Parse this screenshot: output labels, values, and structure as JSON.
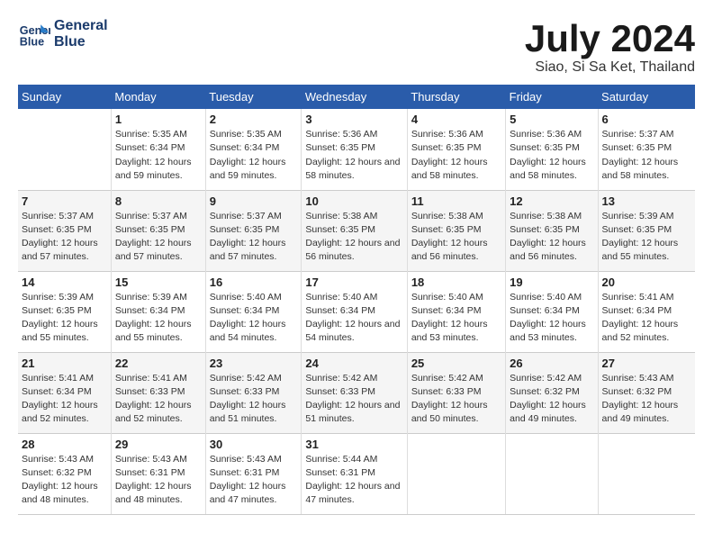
{
  "logo": {
    "line1": "General",
    "line2": "Blue"
  },
  "title": "July 2024",
  "location": "Siao, Si Sa Ket, Thailand",
  "headers": [
    "Sunday",
    "Monday",
    "Tuesday",
    "Wednesday",
    "Thursday",
    "Friday",
    "Saturday"
  ],
  "weeks": [
    [
      {
        "day": "",
        "sunrise": "",
        "sunset": "",
        "daylight": ""
      },
      {
        "day": "1",
        "sunrise": "Sunrise: 5:35 AM",
        "sunset": "Sunset: 6:34 PM",
        "daylight": "Daylight: 12 hours and 59 minutes."
      },
      {
        "day": "2",
        "sunrise": "Sunrise: 5:35 AM",
        "sunset": "Sunset: 6:34 PM",
        "daylight": "Daylight: 12 hours and 59 minutes."
      },
      {
        "day": "3",
        "sunrise": "Sunrise: 5:36 AM",
        "sunset": "Sunset: 6:35 PM",
        "daylight": "Daylight: 12 hours and 58 minutes."
      },
      {
        "day": "4",
        "sunrise": "Sunrise: 5:36 AM",
        "sunset": "Sunset: 6:35 PM",
        "daylight": "Daylight: 12 hours and 58 minutes."
      },
      {
        "day": "5",
        "sunrise": "Sunrise: 5:36 AM",
        "sunset": "Sunset: 6:35 PM",
        "daylight": "Daylight: 12 hours and 58 minutes."
      },
      {
        "day": "6",
        "sunrise": "Sunrise: 5:37 AM",
        "sunset": "Sunset: 6:35 PM",
        "daylight": "Daylight: 12 hours and 58 minutes."
      }
    ],
    [
      {
        "day": "7",
        "sunrise": "Sunrise: 5:37 AM",
        "sunset": "Sunset: 6:35 PM",
        "daylight": "Daylight: 12 hours and 57 minutes."
      },
      {
        "day": "8",
        "sunrise": "Sunrise: 5:37 AM",
        "sunset": "Sunset: 6:35 PM",
        "daylight": "Daylight: 12 hours and 57 minutes."
      },
      {
        "day": "9",
        "sunrise": "Sunrise: 5:37 AM",
        "sunset": "Sunset: 6:35 PM",
        "daylight": "Daylight: 12 hours and 57 minutes."
      },
      {
        "day": "10",
        "sunrise": "Sunrise: 5:38 AM",
        "sunset": "Sunset: 6:35 PM",
        "daylight": "Daylight: 12 hours and 56 minutes."
      },
      {
        "day": "11",
        "sunrise": "Sunrise: 5:38 AM",
        "sunset": "Sunset: 6:35 PM",
        "daylight": "Daylight: 12 hours and 56 minutes."
      },
      {
        "day": "12",
        "sunrise": "Sunrise: 5:38 AM",
        "sunset": "Sunset: 6:35 PM",
        "daylight": "Daylight: 12 hours and 56 minutes."
      },
      {
        "day": "13",
        "sunrise": "Sunrise: 5:39 AM",
        "sunset": "Sunset: 6:35 PM",
        "daylight": "Daylight: 12 hours and 55 minutes."
      }
    ],
    [
      {
        "day": "14",
        "sunrise": "Sunrise: 5:39 AM",
        "sunset": "Sunset: 6:35 PM",
        "daylight": "Daylight: 12 hours and 55 minutes."
      },
      {
        "day": "15",
        "sunrise": "Sunrise: 5:39 AM",
        "sunset": "Sunset: 6:34 PM",
        "daylight": "Daylight: 12 hours and 55 minutes."
      },
      {
        "day": "16",
        "sunrise": "Sunrise: 5:40 AM",
        "sunset": "Sunset: 6:34 PM",
        "daylight": "Daylight: 12 hours and 54 minutes."
      },
      {
        "day": "17",
        "sunrise": "Sunrise: 5:40 AM",
        "sunset": "Sunset: 6:34 PM",
        "daylight": "Daylight: 12 hours and 54 minutes."
      },
      {
        "day": "18",
        "sunrise": "Sunrise: 5:40 AM",
        "sunset": "Sunset: 6:34 PM",
        "daylight": "Daylight: 12 hours and 53 minutes."
      },
      {
        "day": "19",
        "sunrise": "Sunrise: 5:40 AM",
        "sunset": "Sunset: 6:34 PM",
        "daylight": "Daylight: 12 hours and 53 minutes."
      },
      {
        "day": "20",
        "sunrise": "Sunrise: 5:41 AM",
        "sunset": "Sunset: 6:34 PM",
        "daylight": "Daylight: 12 hours and 52 minutes."
      }
    ],
    [
      {
        "day": "21",
        "sunrise": "Sunrise: 5:41 AM",
        "sunset": "Sunset: 6:34 PM",
        "daylight": "Daylight: 12 hours and 52 minutes."
      },
      {
        "day": "22",
        "sunrise": "Sunrise: 5:41 AM",
        "sunset": "Sunset: 6:33 PM",
        "daylight": "Daylight: 12 hours and 52 minutes."
      },
      {
        "day": "23",
        "sunrise": "Sunrise: 5:42 AM",
        "sunset": "Sunset: 6:33 PM",
        "daylight": "Daylight: 12 hours and 51 minutes."
      },
      {
        "day": "24",
        "sunrise": "Sunrise: 5:42 AM",
        "sunset": "Sunset: 6:33 PM",
        "daylight": "Daylight: 12 hours and 51 minutes."
      },
      {
        "day": "25",
        "sunrise": "Sunrise: 5:42 AM",
        "sunset": "Sunset: 6:33 PM",
        "daylight": "Daylight: 12 hours and 50 minutes."
      },
      {
        "day": "26",
        "sunrise": "Sunrise: 5:42 AM",
        "sunset": "Sunset: 6:32 PM",
        "daylight": "Daylight: 12 hours and 49 minutes."
      },
      {
        "day": "27",
        "sunrise": "Sunrise: 5:43 AM",
        "sunset": "Sunset: 6:32 PM",
        "daylight": "Daylight: 12 hours and 49 minutes."
      }
    ],
    [
      {
        "day": "28",
        "sunrise": "Sunrise: 5:43 AM",
        "sunset": "Sunset: 6:32 PM",
        "daylight": "Daylight: 12 hours and 48 minutes."
      },
      {
        "day": "29",
        "sunrise": "Sunrise: 5:43 AM",
        "sunset": "Sunset: 6:31 PM",
        "daylight": "Daylight: 12 hours and 48 minutes."
      },
      {
        "day": "30",
        "sunrise": "Sunrise: 5:43 AM",
        "sunset": "Sunset: 6:31 PM",
        "daylight": "Daylight: 12 hours and 47 minutes."
      },
      {
        "day": "31",
        "sunrise": "Sunrise: 5:44 AM",
        "sunset": "Sunset: 6:31 PM",
        "daylight": "Daylight: 12 hours and 47 minutes."
      },
      {
        "day": "",
        "sunrise": "",
        "sunset": "",
        "daylight": ""
      },
      {
        "day": "",
        "sunrise": "",
        "sunset": "",
        "daylight": ""
      },
      {
        "day": "",
        "sunrise": "",
        "sunset": "",
        "daylight": ""
      }
    ]
  ]
}
